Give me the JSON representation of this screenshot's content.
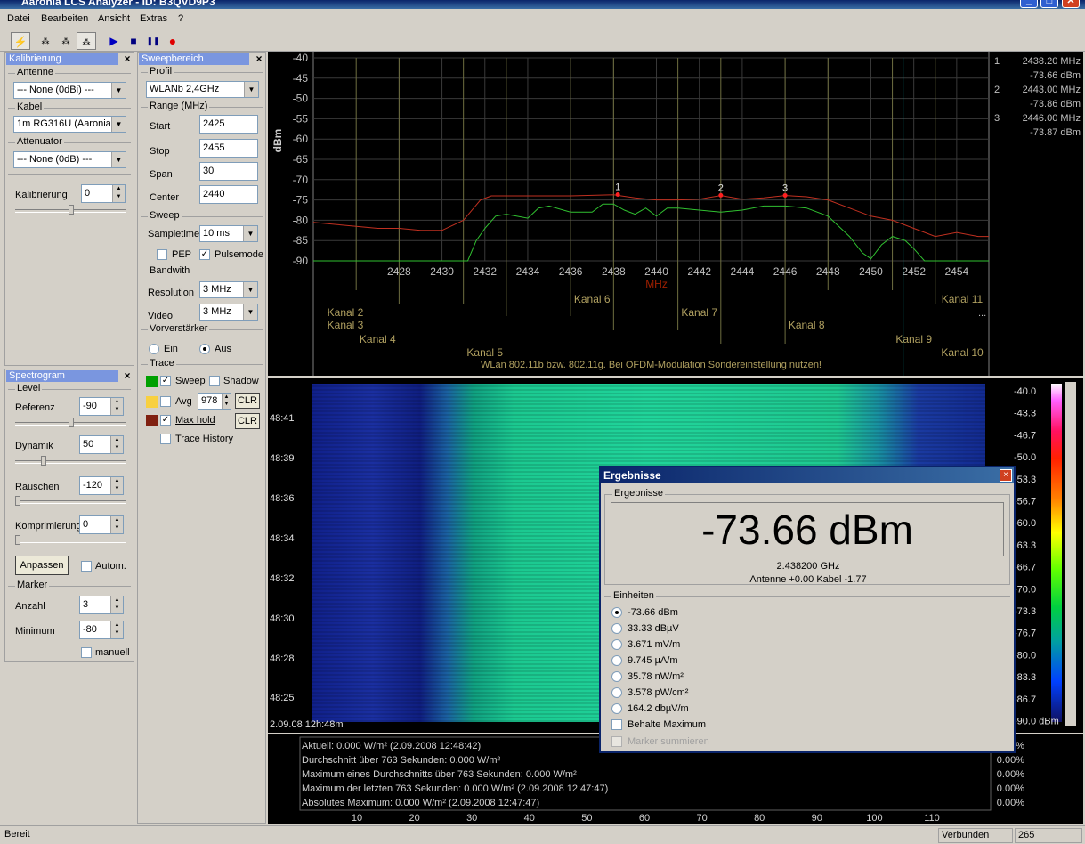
{
  "window": {
    "title": "Aaronia LCS Analyzer - ID: B3QVD9P3",
    "minimize": "_",
    "maximize": "□",
    "close": "✕"
  },
  "menu": [
    "Datei",
    "Bearbeiten",
    "Ansicht",
    "Extras",
    "?"
  ],
  "toolbar": {
    "icons": [
      "lightning-icon",
      "markers-icon",
      "markers-alt-icon",
      "markers-toggle-icon",
      "play-icon",
      "stop-icon",
      "pause-icon",
      "record-icon"
    ],
    "glyphs": [
      "⚡",
      "⁂",
      "⁂",
      "⁂",
      "▶",
      "■",
      "❚❚",
      "●"
    ],
    "record_color": "#e00000",
    "play_color": "#0000c0"
  },
  "kalibrierung": {
    "title": "Kalibrierung",
    "close": "×",
    "antenne_label": "Antenne",
    "antenne_value": "--- None (0dBi) ---",
    "kabel_label": "Kabel",
    "kabel_value": "1m RG316U (Aaronia...",
    "attenuator_label": "Attenuator",
    "attenuator_value": "--- None (0dB) ---",
    "kal_label": "Kalibrierung",
    "kal_value": "0",
    "slider_pos": 0.5
  },
  "sweep": {
    "title": "Sweepbereich",
    "close": "×",
    "profil_label": "Profil",
    "profil_value": "WLANb 2,4GHz",
    "range_label": "Range (MHz)",
    "start_label": "Start",
    "start_value": "2425",
    "stop_label": "Stop",
    "stop_value": "2455",
    "span_label": "Span",
    "span_value": "30",
    "center_label": "Center",
    "center_value": "2440",
    "sweep_label": "Sweep",
    "sampletime_label": "Sampletime",
    "sampletime_value": "10 ms",
    "pep_label": "PEP",
    "pep_checked": false,
    "pulse_label": "Pulsemode",
    "pulse_checked": true,
    "bandwith_label": "Bandwith",
    "res_label": "Resolution",
    "res_value": "3 MHz",
    "video_label": "Video",
    "video_value": "3 MHz",
    "vorv_label": "Vorverstärker",
    "ein_label": "Ein",
    "aus_label": "Aus",
    "aus_selected": true,
    "trace_label": "Trace",
    "sweep_trace_label": "Sweep",
    "sweep_trace_checked": true,
    "shadow_label": "Shadow",
    "shadow_checked": false,
    "avg_label": "Avg",
    "avg_checked": false,
    "avg_value": "978",
    "clr1": "CLR",
    "maxhold_label": "Max hold",
    "maxhold_checked": true,
    "clr2": "CLR",
    "history_label": "Trace History",
    "history_checked": false,
    "color_sweep": "#00a000",
    "color_avg": "#f8d040",
    "color_max": "#802010"
  },
  "spectrogram_panel": {
    "title": "Spectrogram",
    "close": "×",
    "level_label": "Level",
    "ref_label": "Referenz",
    "ref_value": "-90",
    "ref_pos": 0.5,
    "dyn_label": "Dynamik",
    "dyn_value": "50",
    "dyn_pos": 0.25,
    "rausch_label": "Rauschen",
    "rausch_value": "-120",
    "rausch_pos": 0.0,
    "kompr_label": "Komprimierung",
    "kompr_value": "0",
    "kompr_pos": 0.0,
    "anpassen": "Anpassen",
    "autom_label": "Autom.",
    "autom_checked": false,
    "marker_label": "Marker",
    "anzahl_label": "Anzahl",
    "anzahl_value": "3",
    "min_label": "Minimum",
    "min_value": "-80",
    "manuell_label": "manuell",
    "manuell_checked": false
  },
  "chart_data": {
    "type": "line",
    "ylabel": "dBm",
    "xlabel": "MHz",
    "xlim": [
      2424,
      2455.5
    ],
    "ylim": [
      -90,
      -40
    ],
    "yticks": [
      "-40",
      "-45",
      "-50",
      "-55",
      "-60",
      "-65",
      "-70",
      "-75",
      "-80",
      "-85",
      "-90"
    ],
    "xticks": [
      "2428",
      "2430",
      "2432",
      "2434",
      "2436",
      "2438",
      "2440",
      "2442",
      "2444",
      "2446",
      "2448",
      "2450",
      "2452",
      "2454"
    ],
    "grid": true,
    "series": [
      {
        "color": "#c03020",
        "values": [
          [
            2424,
            -80.5
          ],
          [
            2425,
            -81
          ],
          [
            2426,
            -81.5
          ],
          [
            2427,
            -82
          ],
          [
            2428,
            -82
          ],
          [
            2429,
            -82.5
          ],
          [
            2430,
            -82.5
          ],
          [
            2431,
            -80
          ],
          [
            2431.8,
            -75
          ],
          [
            2432.3,
            -74
          ],
          [
            2434,
            -74
          ],
          [
            2436,
            -74
          ],
          [
            2438,
            -73.7
          ],
          [
            2439,
            -74.5
          ],
          [
            2440,
            -75
          ],
          [
            2441,
            -75
          ],
          [
            2442,
            -74.8
          ],
          [
            2443,
            -73.9
          ],
          [
            2444,
            -74.8
          ],
          [
            2445,
            -74.5
          ],
          [
            2446,
            -73.9
          ],
          [
            2447,
            -74.2
          ],
          [
            2448,
            -75
          ],
          [
            2449,
            -77
          ],
          [
            2450,
            -79
          ],
          [
            2451,
            -80
          ],
          [
            2452,
            -82
          ],
          [
            2453,
            -84
          ],
          [
            2454,
            -83
          ],
          [
            2455,
            -84
          ],
          [
            2455.5,
            -84
          ]
        ]
      },
      {
        "color": "#30c030",
        "values": [
          [
            2424,
            -90
          ],
          [
            2430,
            -90
          ],
          [
            2431.2,
            -90
          ],
          [
            2431.6,
            -85
          ],
          [
            2432,
            -82
          ],
          [
            2432.5,
            -79
          ],
          [
            2433,
            -78.5
          ],
          [
            2434,
            -79.5
          ],
          [
            2434.5,
            -77
          ],
          [
            2435,
            -76.5
          ],
          [
            2436,
            -78
          ],
          [
            2437,
            -78
          ],
          [
            2437.5,
            -76
          ],
          [
            2438,
            -76
          ],
          [
            2438.5,
            -77.5
          ],
          [
            2439,
            -78.5
          ],
          [
            2439.5,
            -77
          ],
          [
            2440,
            -79
          ],
          [
            2440.5,
            -77
          ],
          [
            2441,
            -77
          ],
          [
            2442,
            -77.5
          ],
          [
            2443,
            -78
          ],
          [
            2444,
            -77.5
          ],
          [
            2445,
            -76.5
          ],
          [
            2446,
            -76.5
          ],
          [
            2447,
            -77
          ],
          [
            2448,
            -79
          ],
          [
            2449,
            -84
          ],
          [
            2449.6,
            -88
          ],
          [
            2450,
            -89.5
          ],
          [
            2450.5,
            -86
          ],
          [
            2451,
            -84
          ],
          [
            2451.6,
            -85
          ],
          [
            2452,
            -87
          ],
          [
            2452.5,
            -90
          ],
          [
            2455.5,
            -90
          ]
        ]
      }
    ],
    "markers": [
      {
        "label": "1",
        "x": 2438.2,
        "y": -73.66
      },
      {
        "label": "2",
        "x": 2443.0,
        "y": -73.86
      },
      {
        "label": "3",
        "x": 2446.0,
        "y": -73.87
      }
    ],
    "channels": [
      {
        "label": "Kanal 2",
        "center": 2417
      },
      {
        "label": "Kanal 3",
        "center": 2422
      },
      {
        "label": "Kanal 4",
        "center": 2427
      },
      {
        "label": "Kanal 5",
        "center": 2432
      },
      {
        "label": "Kanal 6",
        "center": 2437
      },
      {
        "label": "Kanal 7",
        "center": 2442
      },
      {
        "label": "Kanal 8",
        "center": 2447
      },
      {
        "label": "Kanal 9",
        "center": 2452
      },
      {
        "label": "Kanal 10",
        "center": 2457
      },
      {
        "label": "Kanal 11",
        "center": 2462
      }
    ],
    "note": "WLan 802.11b bzw. 802.11g. Bei OFDM-Modulation Sondereinstellung nutzen!",
    "marker_readout": [
      {
        "n": "1",
        "freq": "2438.20 MHz",
        "level": "-73.66 dBm"
      },
      {
        "n": "2",
        "freq": "2443.00 MHz",
        "level": "-73.86 dBm"
      },
      {
        "n": "3",
        "freq": "2446.00 MHz",
        "level": "-73.87 dBm"
      }
    ],
    "overflow_glyph": "..."
  },
  "spectrogram": {
    "time_labels": [
      "48:41",
      "48:39",
      "48:36",
      "48:34",
      "48:32",
      "48:30",
      "48:28",
      "48:25"
    ],
    "date_label": "2.09.08 12h:48m",
    "scale": [
      "-40.0",
      "-43.3",
      "-46.7",
      "-50.0",
      "-53.3",
      "-56.7",
      "-60.0",
      "-63.3",
      "-66.7",
      "-70.0",
      "-73.3",
      "-76.7",
      "-80.0",
      "-83.3",
      "-86.7",
      "-90.0 dBm"
    ]
  },
  "stats": {
    "lines": [
      "Aktuell: 0.000 W/m² (2.09.2008 12:48:42)",
      "Durchschnitt über 763 Sekunden: 0.000 W/m²",
      "Maximum eines Durchschnitts über 763 Sekunden: 0.000 W/m²",
      "Maximum der letzten 763 Sekunden: 0.000 W/m² (2.09.2008 12:47:47)",
      "Absolutes Maximum: 0.000 W/m² (2.09.2008 12:47:47)"
    ],
    "percent": [
      "%",
      "0.00%",
      "0.00%",
      "0.00%",
      "0.00%"
    ],
    "xticks": [
      "10",
      "20",
      "30",
      "40",
      "50",
      "60",
      "70",
      "80",
      "90",
      "100",
      "110"
    ]
  },
  "dialog": {
    "title": "Ergebnisse",
    "close": "×",
    "group": "Ergebnisse",
    "big_value": "-73.66 dBm",
    "freq": "2.438200 GHz",
    "antenna": "Antenne +0.00 Kabel -1.77",
    "einheiten_label": "Einheiten",
    "units": [
      "-73.66 dBm",
      "33.33 dBµV",
      "3.671 mV/m",
      "9.745 µA/m",
      "35.78 nW/m²",
      "3.578 pW/cm²",
      "164.2 dbµV/m"
    ],
    "selected_unit": 0,
    "behalte_label": "Behalte Maximum",
    "marker_sum_label": "Marker summieren"
  },
  "status": {
    "left": "Bereit",
    "conn": "Verbunden",
    "num": "265"
  }
}
